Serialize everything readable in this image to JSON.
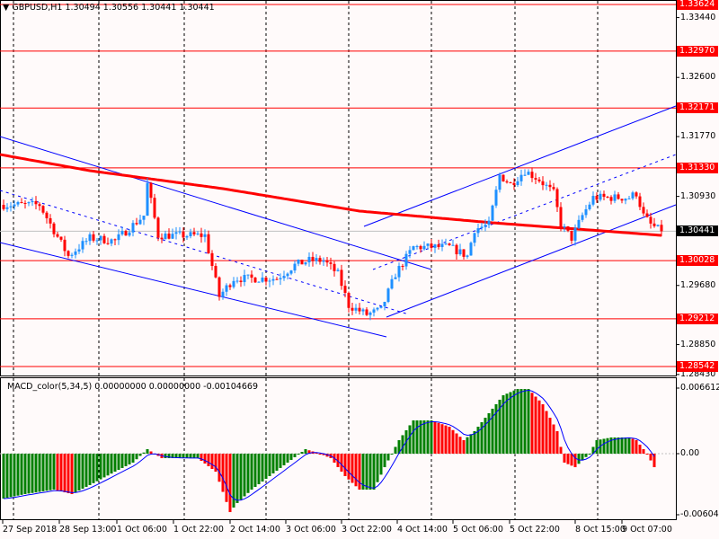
{
  "header": {
    "symbol_line": "GBPUSD,H1  1.30494 1.30556 1.30441 1.30441",
    "menu_icon": "triangle-down-icon"
  },
  "macd_header": "MACD_color(5,34,5) 0.00000000 0.00000000 -0.00104669",
  "price_axis": {
    "ticks": [
      "1.33440",
      "1.32600",
      "1.31770",
      "1.30930",
      "1.29680",
      "1.28850",
      "1.28430"
    ],
    "ticks_values": [
      1.3344,
      1.326,
      1.3177,
      1.3093,
      1.2968,
      1.2885,
      1.2843
    ],
    "levels": [
      "1.33624",
      "1.32970",
      "1.32171",
      "1.31330",
      "1.30028",
      "1.29212",
      "1.28542"
    ],
    "current": "1.30441"
  },
  "macd_axis": {
    "top": "0.006612",
    "zero": "0.00",
    "bottom": "-0.006040"
  },
  "time_axis": [
    "27 Sep 2018",
    "28 Sep 13:00",
    "1 Oct 06:00",
    "1 Oct 22:00",
    "2 Oct 14:00",
    "3 Oct 06:00",
    "3 Oct 22:00",
    "4 Oct 14:00",
    "5 Oct 06:00",
    "5 Oct 22:00",
    "8 Oct 15:00",
    "9 Oct 07:00"
  ],
  "colors": {
    "bull": "#1e90ff",
    "bear": "#ff0000",
    "level": "#ff0000",
    "ma": "#ff0000",
    "channel": "#0000ff",
    "macd_up": "#008000",
    "macd_down": "#ff0000",
    "signal": "#0000ff"
  },
  "chart_data": {
    "type": "candlestick",
    "symbol": "GBPUSD",
    "timeframe": "H1",
    "ylim": [
      1.2843,
      1.33624
    ],
    "close_path": [
      [
        1,
        1.30812
      ],
      [
        11,
        1.30812
      ],
      [
        19,
        1.30093
      ],
      [
        25,
        1.30345
      ],
      [
        32,
        1.30307
      ],
      [
        40,
        1.30661
      ],
      [
        41,
        1.31102
      ],
      [
        44,
        1.30383
      ],
      [
        50,
        1.30383
      ],
      [
        57,
        1.30383
      ],
      [
        61,
        1.29526
      ],
      [
        65,
        1.29778
      ],
      [
        70,
        1.29778
      ],
      [
        77,
        1.29778
      ],
      [
        82,
        1.29967
      ],
      [
        86,
        1.3003
      ],
      [
        90,
        1.3003
      ],
      [
        94,
        1.29841
      ],
      [
        97,
        1.294
      ],
      [
        102,
        1.29273
      ],
      [
        106,
        1.29336
      ],
      [
        110,
        1.29841
      ],
      [
        115,
        1.30219
      ],
      [
        120,
        1.30219
      ],
      [
        125,
        1.30219
      ],
      [
        130,
        1.30093
      ],
      [
        132,
        1.30471
      ],
      [
        136,
        1.30534
      ],
      [
        139,
        1.31228
      ],
      [
        142,
        1.31102
      ],
      [
        146,
        1.31291
      ],
      [
        150,
        1.31165
      ],
      [
        154,
        1.30976
      ],
      [
        156,
        1.30534
      ],
      [
        159,
        1.30345
      ],
      [
        162,
        1.30661
      ],
      [
        165,
        1.30913
      ],
      [
        170,
        1.30913
      ],
      [
        175,
        1.30913
      ],
      [
        177,
        1.30976
      ],
      [
        179,
        1.30661
      ],
      [
        181,
        1.30534
      ],
      [
        184,
        1.30441
      ]
    ],
    "moving_average": [
      [
        0,
        1.31518
      ],
      [
        25,
        1.31291
      ],
      [
        62,
        1.31039
      ],
      [
        100,
        1.30724
      ],
      [
        137,
        1.3056
      ],
      [
        184,
        1.30383
      ]
    ],
    "macd_histogram": [
      [
        1,
        -0.00452
      ],
      [
        7,
        -0.00407
      ],
      [
        15,
        -0.00362
      ],
      [
        20,
        -0.00407
      ],
      [
        25,
        -0.00316
      ],
      [
        32,
        -0.00181
      ],
      [
        37,
        -0.0009
      ],
      [
        41,
        0.00045
      ],
      [
        45,
        -0.00045
      ],
      [
        55,
        -0.00045
      ],
      [
        60,
        -0.00181
      ],
      [
        64,
        -0.00588
      ],
      [
        66,
        -0.00497
      ],
      [
        70,
        -0.00362
      ],
      [
        75,
        -0.00226
      ],
      [
        80,
        -0.0009
      ],
      [
        85,
        0.00045
      ],
      [
        89,
        0.0
      ],
      [
        92,
        -0.00045
      ],
      [
        96,
        -0.00226
      ],
      [
        100,
        -0.00362
      ],
      [
        104,
        -0.00362
      ],
      [
        107,
        -0.00136
      ],
      [
        111,
        0.00136
      ],
      [
        115,
        0.00335
      ],
      [
        120,
        0.00335
      ],
      [
        125,
        0.00271
      ],
      [
        129,
        0.00136
      ],
      [
        132,
        0.00226
      ],
      [
        136,
        0.00407
      ],
      [
        140,
        0.00588
      ],
      [
        144,
        0.00651
      ],
      [
        147,
        0.00651
      ],
      [
        151,
        0.00497
      ],
      [
        155,
        0.00226
      ],
      [
        157,
        -0.0009
      ],
      [
        160,
        -0.00136
      ],
      [
        164,
        0.0
      ],
      [
        166,
        0.00136
      ],
      [
        170,
        0.00163
      ],
      [
        175,
        0.00163
      ],
      [
        177,
        0.00136
      ],
      [
        180,
        0.0
      ],
      [
        182,
        -0.00136
      ]
    ]
  }
}
